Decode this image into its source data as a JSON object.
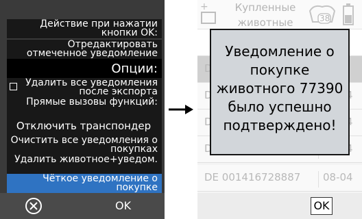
{
  "header": {
    "tab_label": "Купленные животные",
    "badge_count": "38"
  },
  "table": {
    "rows": [
      {
        "id": "DE",
        "date": "4"
      },
      {
        "id": "DE",
        "date": "08-04"
      },
      {
        "id": "DE",
        "date": "08-04"
      },
      {
        "id": "DE",
        "date": "08-04"
      },
      {
        "id": "DE 001416728887",
        "date": "08-04"
      }
    ]
  },
  "menu": {
    "items": [
      {
        "label": "Действие при нажатии кнопки OK:"
      },
      {
        "label": "Отредактировать отмеченное уведомление"
      },
      {
        "label": "Опции:"
      },
      {
        "label": "Удалить все уведомления после экспорта"
      },
      {
        "label": "Прямые вызовы функций:"
      },
      {
        "label": "Отключить транспондер"
      },
      {
        "label": "Очистить все уведомления о покупках"
      },
      {
        "label": "Удалить животное+уведом."
      },
      {
        "label": "Чёткое уведомление о покупке"
      }
    ]
  },
  "bottom_bar": {
    "ok_label": "OK"
  },
  "dialog": {
    "message": "Уведомление о покупке животного 77390 было успешно подтверждено!",
    "ok_label": "OK"
  },
  "colors": {
    "menu_bg": "#181818",
    "menu_selected": "#2f73c2",
    "dialog_bg": "#d2d6da",
    "bottom_bar": "#4a4a4a"
  }
}
